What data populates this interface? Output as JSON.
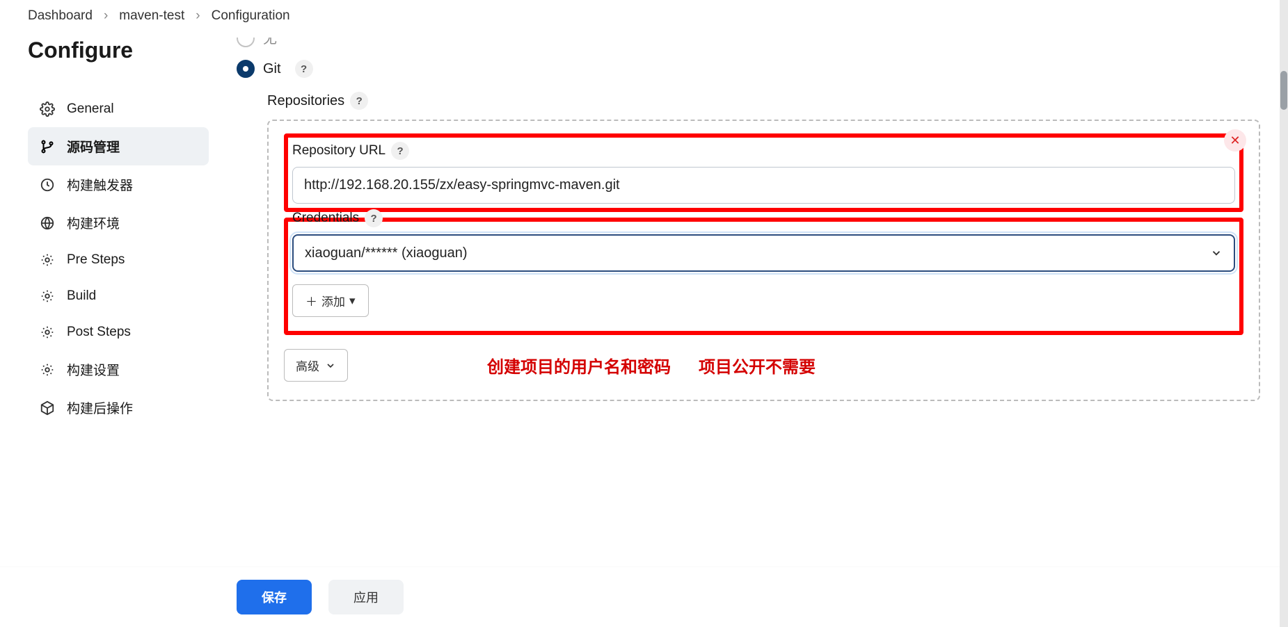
{
  "breadcrumb": {
    "dashboard": "Dashboard",
    "project": "maven-test",
    "page": "Configuration"
  },
  "sidebar": {
    "title": "Configure",
    "items": [
      {
        "label": "General"
      },
      {
        "label": "源码管理"
      },
      {
        "label": "构建触发器"
      },
      {
        "label": "构建环境"
      },
      {
        "label": "Pre Steps"
      },
      {
        "label": "Build"
      },
      {
        "label": "Post Steps"
      },
      {
        "label": "构建设置"
      },
      {
        "label": "构建后操作"
      }
    ]
  },
  "scm": {
    "none_label": "无",
    "git_label": "Git",
    "repositories_label": "Repositories",
    "repo_url_label": "Repository URL",
    "repo_url_value": "http://192.168.20.155/zx/easy-springmvc-maven.git",
    "credentials_label": "Credentials",
    "credentials_value": "xiaoguan/****** (xiaoguan)",
    "add_label": "添加",
    "advanced_label": "高级"
  },
  "annotation": {
    "part1": "创建项目的用户名和密码",
    "part2": "项目公开不需要"
  },
  "footer": {
    "save": "保存",
    "apply": "应用"
  }
}
